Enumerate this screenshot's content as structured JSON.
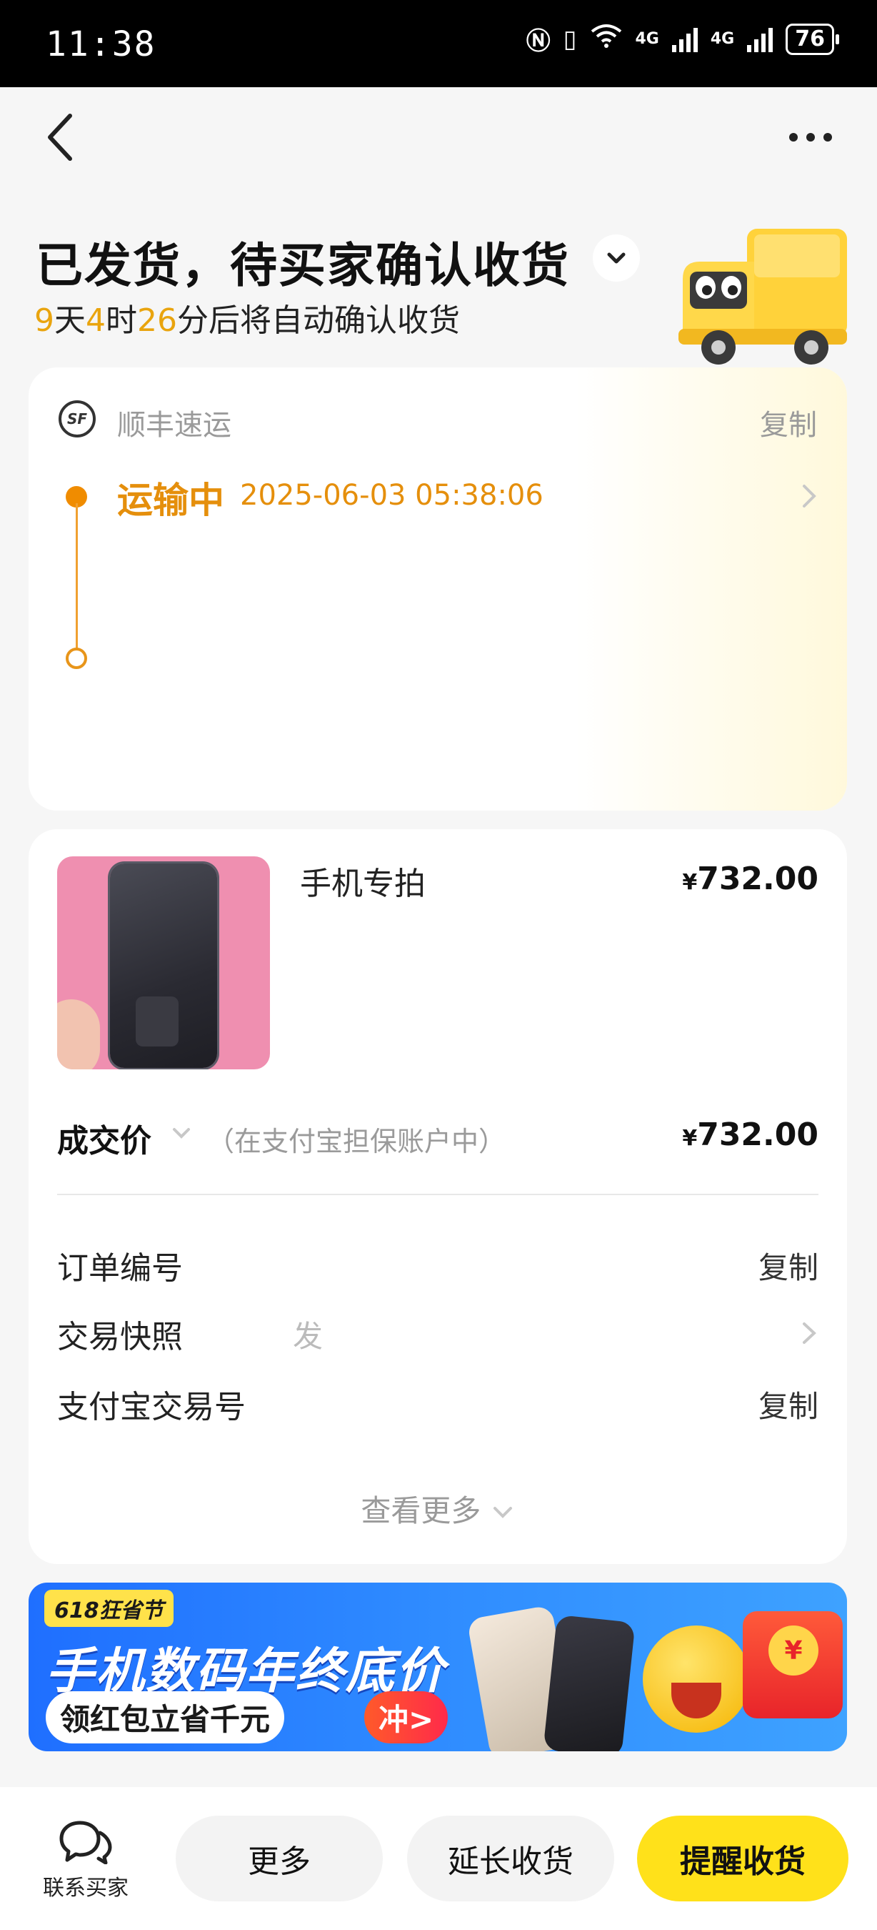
{
  "status_bar": {
    "time": "11:38",
    "network1": "4G",
    "network2": "4G",
    "battery": "76"
  },
  "header": {
    "status_title": "已发货，待买家确认收货",
    "countdown": {
      "days": "9",
      "days_unit": "天",
      "hours": "4",
      "hours_unit": "时",
      "minutes": "26",
      "minutes_suffix": "分后将自动确认收货"
    }
  },
  "logistics": {
    "carrier_logo": "SF",
    "carrier": "顺丰速运",
    "copy_label": "复制",
    "latest_status": "运输中",
    "latest_time": "2025-06-03 05:38:06"
  },
  "order": {
    "product_name": "手机专拍",
    "product_price": "732.00",
    "currency": "¥",
    "deal_label": "成交价",
    "deal_note": "（在支付宝担保账户中）",
    "deal_price": "732.00",
    "rows": [
      {
        "label": "订单编号",
        "value": "",
        "action": "复制"
      },
      {
        "label": "交易快照",
        "value": "发",
        "action": ""
      },
      {
        "label": "支付宝交易号",
        "value": "",
        "action": "复制"
      }
    ],
    "view_more": "查看更多"
  },
  "banner": {
    "badge": "618狂省节",
    "title": "手机数码年终底价",
    "subtitle": "领红包立省千元",
    "cta": "冲>",
    "coin": "¥"
  },
  "bottom_bar": {
    "contact_label": "联系买家",
    "more_label": "更多",
    "extend_label": "延长收货",
    "remind_label": "提醒收货"
  },
  "colors": {
    "accent_orange": "#e58f0c",
    "primary_yellow": "#ffe11a",
    "banner_blue": "#2f8cff"
  }
}
